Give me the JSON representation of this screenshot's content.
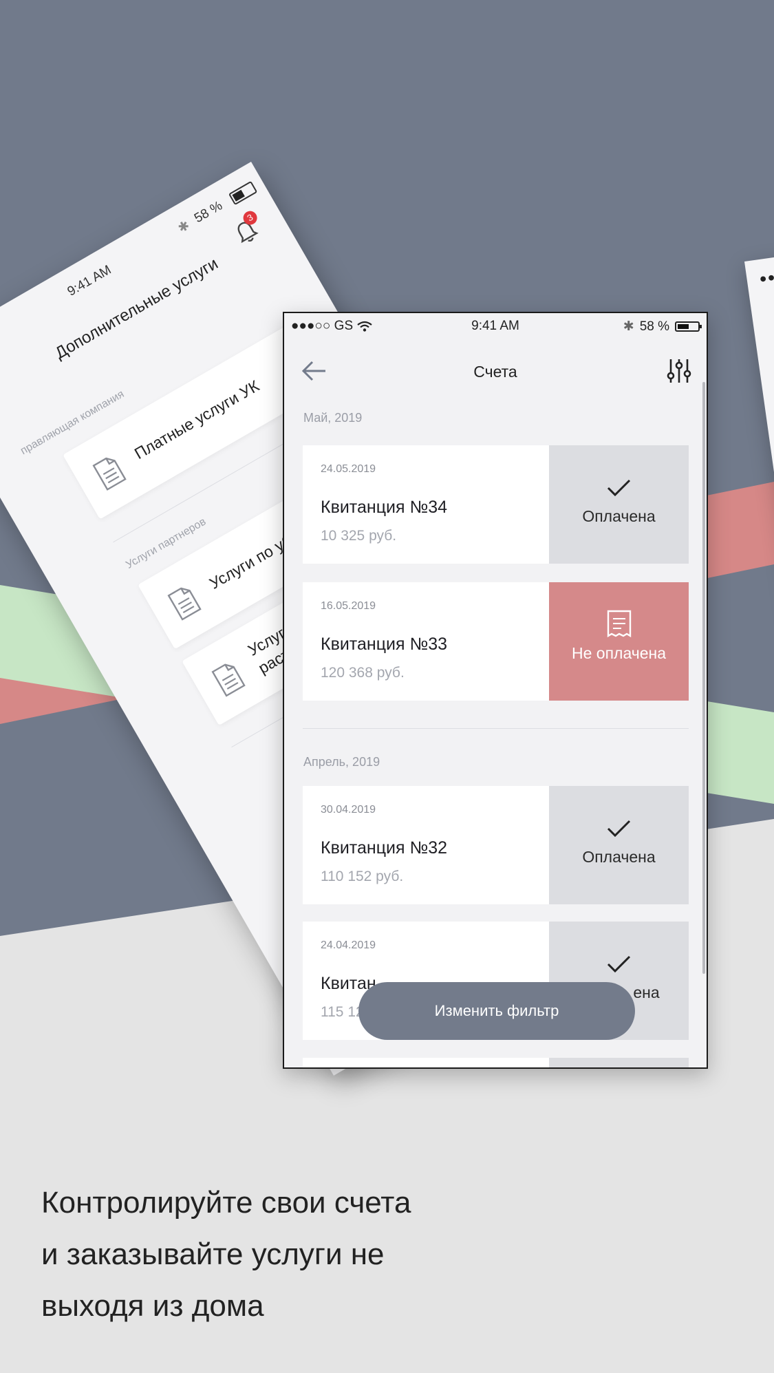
{
  "colors": {
    "background_top": "#717a8b",
    "background_bottom": "#e4e4e4",
    "stripe_red": "#d68887",
    "stripe_green": "#c7e6c5",
    "paid_bg": "#dcdde1",
    "unpaid_bg": "#d5898a",
    "button_bg": "#737b8b"
  },
  "back_phone": {
    "time": "9:41 AM",
    "battery": "58 %",
    "notification_count": "3",
    "title": "Дополнительные услуги",
    "section_company": "правляющая компания",
    "item_paid_services": "Платные услуги УК",
    "section_partners": "Услуги партнеров",
    "item_cleaning": "Услуги по уборке",
    "item_plants_line1": "Услуги по у",
    "item_plants_line2": "растения"
  },
  "main_phone": {
    "status": {
      "carrier": "●●●○○ GS",
      "time": "9:41 AM",
      "battery": "58 %"
    },
    "nav": {
      "title": "Счета",
      "back_icon": "arrow-left-icon",
      "filter_icon": "sliders-icon"
    },
    "groups": [
      {
        "month": "Май, 2019",
        "invoices": [
          {
            "date": "24.05.2019",
            "name": "Квитанция №34",
            "sum": "10 325 руб.",
            "status": "Оплачена",
            "status_icon": "check-icon"
          },
          {
            "date": "16.05.2019",
            "name": "Квитанция №33",
            "sum": "120 368 руб.",
            "status": "Не оплачена",
            "status_icon": "receipt-icon"
          }
        ]
      },
      {
        "month": "Апрель, 2019",
        "invoices": [
          {
            "date": "30.04.2019",
            "name": "Квитанция №32",
            "sum": "110 152 руб.",
            "status": "Оплачена",
            "status_icon": "check-icon"
          },
          {
            "date": "24.04.2019",
            "name": "Квитанция №31",
            "sum": "115 12",
            "status": "ена",
            "status_icon": "check-icon"
          }
        ]
      }
    ],
    "filter_button": "Изменить фильтр"
  },
  "caption": {
    "line1": "Контролируйте свои счета",
    "line2": "и заказывайте услуги не",
    "line3": "выходя из дома"
  }
}
